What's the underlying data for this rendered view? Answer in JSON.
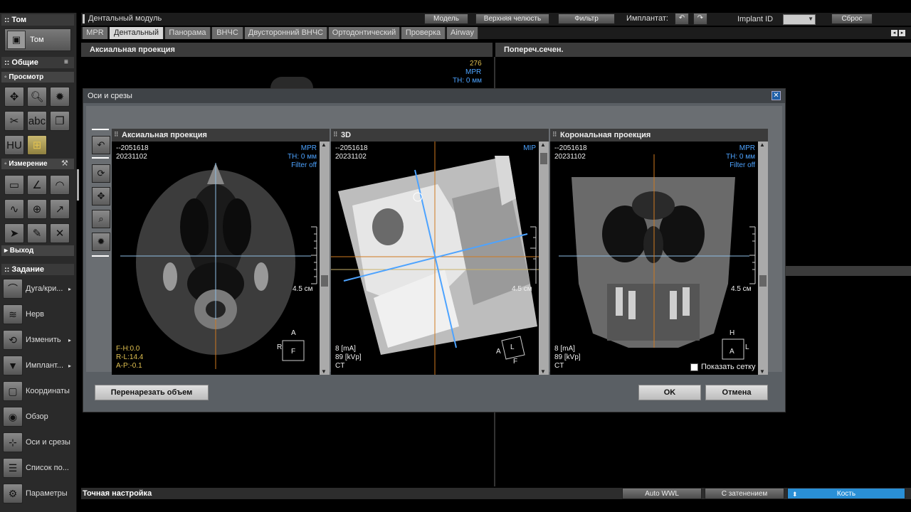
{
  "sidebar": {
    "tom_header": ":: Том",
    "tom_button": "Том",
    "general_header": ":: Общие",
    "view_header": "◦ Просмотр",
    "measure_header": "◦ Измерение",
    "exit_header": "▸ Выход",
    "task_header": ":: Задание",
    "tasks": [
      {
        "label": "Дуга/кри...",
        "icon": "arch-icon",
        "arrow": "▸"
      },
      {
        "label": "Нерв",
        "icon": "nerve-icon",
        "arrow": ""
      },
      {
        "label": "Изменить",
        "icon": "edit-icon",
        "arrow": "▸"
      },
      {
        "label": "Имплант...",
        "icon": "implant-icon",
        "arrow": "▸"
      },
      {
        "label": "Координаты",
        "icon": "coordinates-icon",
        "arrow": ""
      },
      {
        "label": "Обзор",
        "icon": "overview-icon",
        "arrow": ""
      },
      {
        "label": "Оси и срезы",
        "icon": "axes-slices-icon",
        "arrow": ""
      },
      {
        "label": "Список по...",
        "icon": "list-icon",
        "arrow": ""
      },
      {
        "label": "Параметры",
        "icon": "parameters-icon",
        "arrow": ""
      }
    ]
  },
  "topbar": {
    "module_title": "Дентальный модуль",
    "model_btn": "Модель",
    "upper_jaw_btn": "Верхняя челюсть",
    "filter_btn": "Фильтр",
    "implant_label": "Имплантат:",
    "implant_id_label": "Implant ID",
    "reset_btn": "Сброс"
  },
  "tabs": [
    "MPR",
    "Дентальный",
    "Панорама",
    "ВНЧС",
    "Двусторонний ВНЧС",
    "Ортодонтический",
    "Проверка",
    "Airway"
  ],
  "panels": {
    "axial": "Аксиальная проекция",
    "cross": "Попереч.сечен.",
    "bg_info": [
      "276",
      "MPR",
      "TH: 0 мм"
    ]
  },
  "dialog": {
    "title": "Оси и срезы",
    "show_grid_label": "Показать сетку",
    "reslice_btn": "Перенарезать объем",
    "ok_btn": "OK",
    "cancel_btn": "Отмена",
    "viewports": [
      {
        "title": "Аксиальная проекция",
        "id": "--2051618",
        "date": "20231102",
        "mode": "MPR",
        "th": "TH: 0 мм",
        "filter": "Filter off",
        "scale": "4.5 см",
        "coords": [
          "F-H:0.0",
          "R-L:14.4",
          "A-P:-0.1"
        ],
        "orient": [
          "A",
          "R",
          "F"
        ]
      },
      {
        "title": "3D",
        "id": "--2051618",
        "date": "20231102",
        "mode": "MIP",
        "scale": "4.5 см",
        "params": [
          "8 [mA]",
          "89 [kVp]",
          "CT"
        ],
        "orient": [
          "L",
          "A",
          "F"
        ]
      },
      {
        "title": "Корональная проекция",
        "id": "--2051618",
        "date": "20231102",
        "mode": "MPR",
        "th": "TH: 0 мм",
        "filter": "Filter off",
        "scale": "4.5 см",
        "params": [
          "8 [mA]",
          "89 [kVp]",
          "CT"
        ],
        "orient": [
          "H",
          "A",
          "L"
        ]
      }
    ]
  },
  "bottombar": {
    "fine_tune": "Точная настройка",
    "auto_wwl": "Auto WWL",
    "shading": "С затенением",
    "bone": "Кость"
  },
  "colors": {
    "accent_blue": "#4da3ff",
    "crosshair_blue": "#8fbfe6",
    "crosshair_orange": "#d07a20",
    "bone_select": "#2a8fd6"
  }
}
